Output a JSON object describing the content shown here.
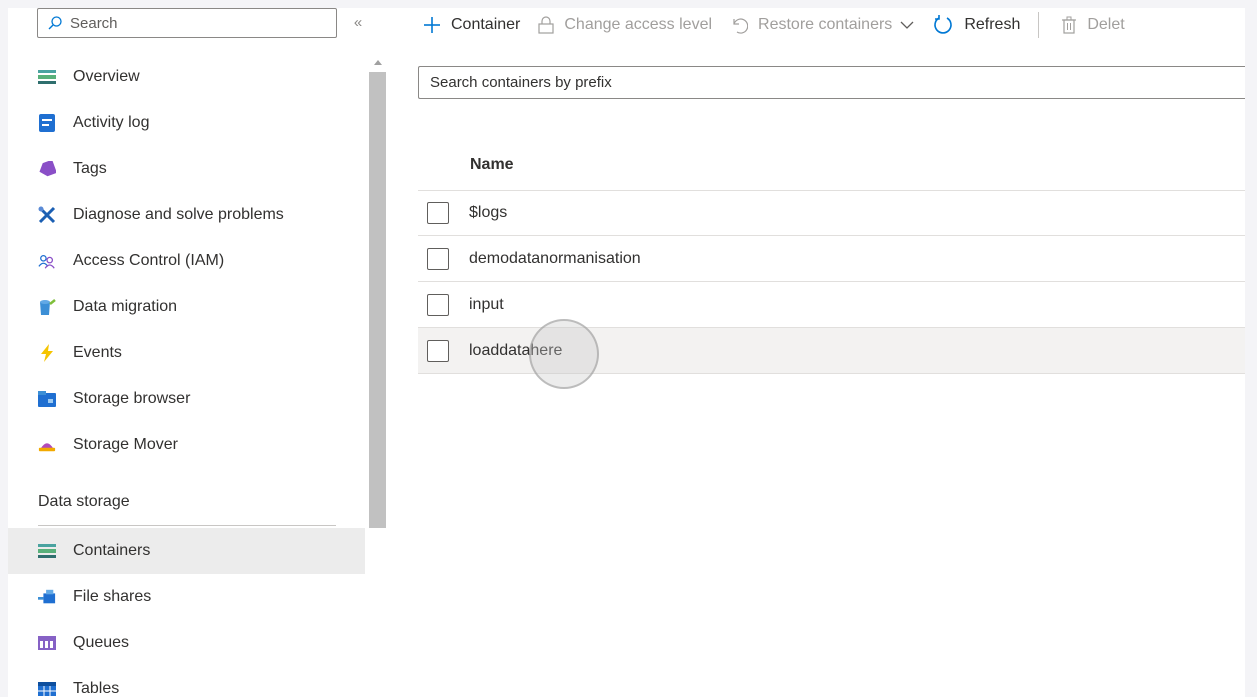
{
  "sidebar": {
    "search_placeholder": "Search",
    "collapse_glyph": "«",
    "items": [
      {
        "label": "Overview",
        "icon": "overview-icon"
      },
      {
        "label": "Activity log",
        "icon": "activity-log-icon"
      },
      {
        "label": "Tags",
        "icon": "tag-icon"
      },
      {
        "label": "Diagnose and solve problems",
        "icon": "wrench-icon"
      },
      {
        "label": "Access Control (IAM)",
        "icon": "people-icon"
      },
      {
        "label": "Data migration",
        "icon": "data-migration-icon"
      },
      {
        "label": "Events",
        "icon": "lightning-icon"
      },
      {
        "label": "Storage browser",
        "icon": "storage-browser-icon"
      },
      {
        "label": "Storage Mover",
        "icon": "storage-mover-icon"
      }
    ],
    "section_title": "Data storage",
    "data_storage_items": [
      {
        "label": "Containers",
        "icon": "containers-icon",
        "selected": true
      },
      {
        "label": "File shares",
        "icon": "file-shares-icon"
      },
      {
        "label": "Queues",
        "icon": "queues-icon"
      },
      {
        "label": "Tables",
        "icon": "tables-icon"
      }
    ]
  },
  "toolbar": {
    "container_label": "Container",
    "change_access_label": "Change access level",
    "restore_label": "Restore containers",
    "refresh_label": "Refresh",
    "delete_label": "Delet"
  },
  "search": {
    "placeholder": "Search containers by prefix"
  },
  "table": {
    "column_name": "Name",
    "rows": [
      {
        "name": "$logs"
      },
      {
        "name": "demodatanormanisation"
      },
      {
        "name": "input"
      },
      {
        "name": "loaddatahere"
      }
    ]
  },
  "colors": {
    "accent": "#0078d4",
    "selected_bg": "#ececec",
    "hover_row_bg": "#f3f2f1"
  }
}
